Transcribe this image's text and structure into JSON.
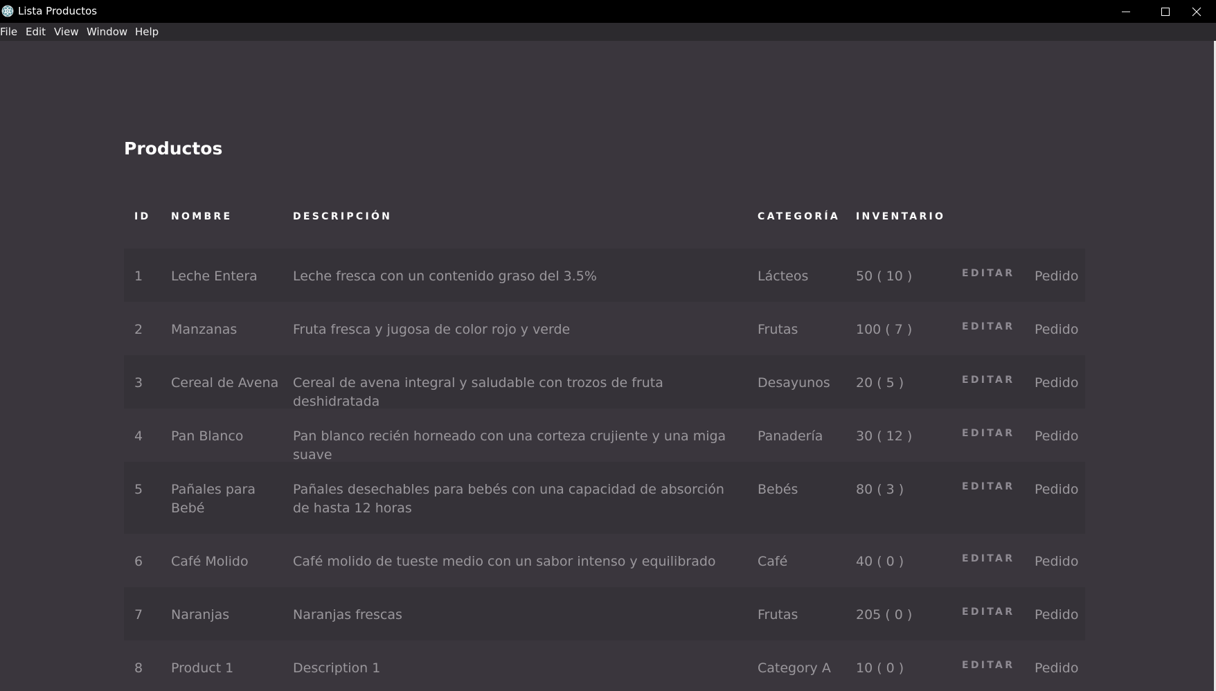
{
  "window": {
    "title": "Lista Productos",
    "controls": [
      "minimize",
      "maximize",
      "close"
    ]
  },
  "menu": [
    "File",
    "Edit",
    "View",
    "Window",
    "Help"
  ],
  "page": {
    "title": "Productos"
  },
  "table": {
    "headers": [
      "ID",
      "NOMBRE",
      "DESCRIPCIÓN",
      "CATEGORÍA",
      "INVENTARIO"
    ],
    "rows": [
      {
        "id": "1",
        "name": "Leche Entera",
        "description": "Leche fresca con un contenido graso del 3.5%",
        "category": "Lácteos",
        "inventory": "50 ( 10 )",
        "edit": "EDITAR",
        "order": "Pedido"
      },
      {
        "id": "2",
        "name": "Manzanas",
        "description": "Fruta fresca y jugosa de color rojo y verde",
        "category": "Frutas",
        "inventory": "100 ( 7 )",
        "edit": "EDITAR",
        "order": "Pedido"
      },
      {
        "id": "3",
        "name": "Cereal de Avena",
        "description": "Cereal de avena integral y saludable con trozos de fruta deshidratada",
        "category": "Desayunos",
        "inventory": "20 ( 5 )",
        "edit": "EDITAR",
        "order": "Pedido"
      },
      {
        "id": "4",
        "name": "Pan Blanco",
        "description": "Pan blanco recién horneado con una corteza crujiente y una miga suave",
        "category": "Panadería",
        "inventory": "30 ( 12 )",
        "edit": "EDITAR",
        "order": "Pedido"
      },
      {
        "id": "5",
        "name": "Pañales para Bebé",
        "description": "Pañales desechables para bebés con una capacidad de absorción de hasta 12 horas",
        "category": "Bebés",
        "inventory": "80 ( 3 )",
        "edit": "EDITAR",
        "order": "Pedido"
      },
      {
        "id": "6",
        "name": "Café Molido",
        "description": "Café molido de tueste medio con un sabor intenso y equilibrado",
        "category": "Café",
        "inventory": "40 ( 0 )",
        "edit": "EDITAR",
        "order": "Pedido"
      },
      {
        "id": "7",
        "name": "Naranjas",
        "description": "Naranjas frescas",
        "category": "Frutas",
        "inventory": "205 ( 0 )",
        "edit": "EDITAR",
        "order": "Pedido"
      },
      {
        "id": "8",
        "name": "Product 1",
        "description": "Description 1",
        "category": "Category A",
        "inventory": "10 ( 0 )",
        "edit": "EDITAR",
        "order": "Pedido"
      }
    ]
  },
  "colors": {
    "titlebar": "#000000",
    "menubar": "#2c2a2e",
    "background": "#3a363d",
    "row_background": "#353238",
    "header_text": "#ffffff",
    "cell_text": "#9a979c"
  }
}
